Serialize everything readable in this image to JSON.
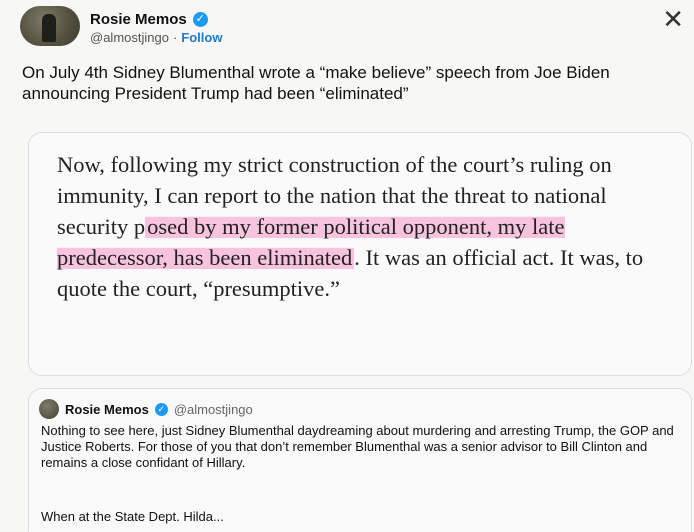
{
  "author": {
    "name": "Rosie Memos",
    "handle": "@almostjingo",
    "separator": "·",
    "follow_label": "Follow",
    "verified_glyph": "✓"
  },
  "close_glyph": "✕",
  "tweet": {
    "text": "On July 4th Sidney Blumenthal wrote a “make believe” speech from Joe Biden announcing President Trump had been “eliminated”"
  },
  "quote_image": {
    "before": "Now, following my strict construction of the court’s ruling on immunity, I can report to the nation that the threat to national security p",
    "highlighted": "osed by my former political opponent, my late predecessor, has been eliminated",
    "after": ". It was an official act. It was, to quote the court, “presumptive.”"
  },
  "quoted_post": {
    "name": "Rosie Memos",
    "handle": "@almostjingo",
    "text": "Nothing to see here, just Sidney Blumenthal daydreaming about murdering and arresting Trump, the GOP and Justice Roberts. For those of you that don’t remember Blumenthal was a senior advisor to Bill Clinton and remains a close confidant of Hillary.",
    "more": "When at the State Dept. Hilda..."
  },
  "colors": {
    "accent": "#1d9bf0",
    "highlight": "#f596c8"
  }
}
